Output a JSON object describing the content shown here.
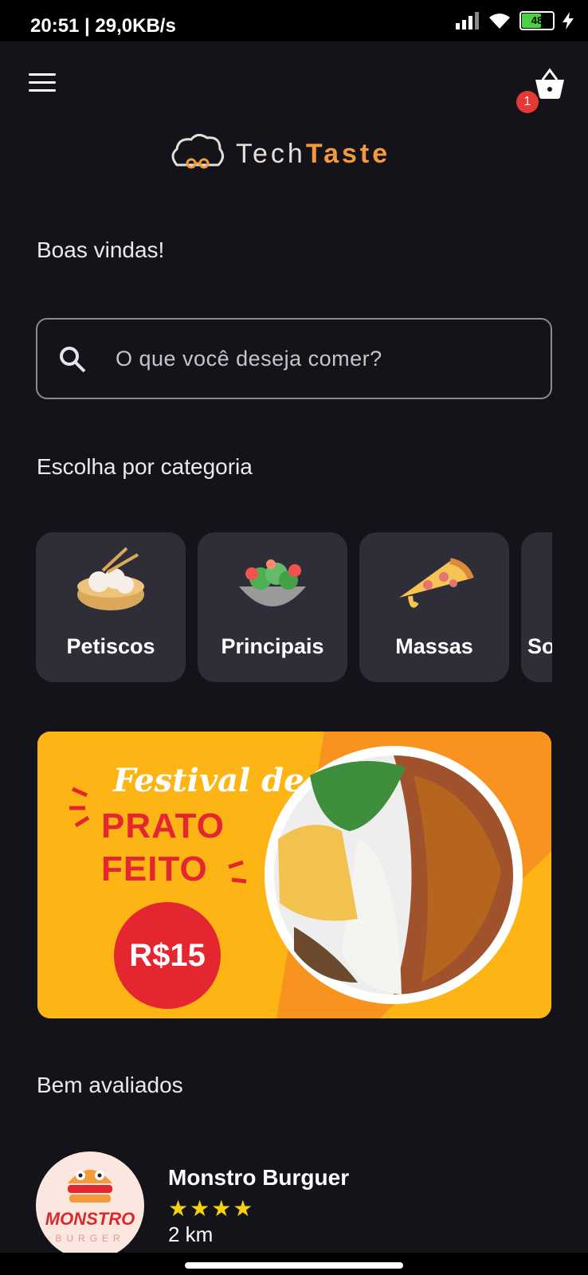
{
  "status_bar": {
    "time": "20:51 | 29,0KB/s",
    "battery": "48"
  },
  "header": {
    "cart_count": "1"
  },
  "logo": {
    "part1": "Tech",
    "part2": "Taste"
  },
  "greeting": "Boas vindas!",
  "search": {
    "placeholder": "O que você deseja comer?"
  },
  "categories": {
    "title": "Escolha por categoria",
    "items": [
      {
        "label": "Petiscos",
        "icon": "dumplings-icon"
      },
      {
        "label": "Principais",
        "icon": "salad-bowl-icon"
      },
      {
        "label": "Massas",
        "icon": "pizza-icon"
      },
      {
        "label": "So",
        "icon": ""
      }
    ]
  },
  "banner": {
    "festival": "Festival de",
    "line1": "PRATO",
    "line2": "FEITO",
    "price": "R$15"
  },
  "top_rated": {
    "title": "Bem avaliados",
    "restaurants": [
      {
        "name": "Monstro Burguer",
        "stars": "★★★★",
        "rating": 4,
        "distance": "2 km",
        "logo_text": "MONSTRO",
        "logo_sub": "BURGER"
      }
    ]
  },
  "colors": {
    "background": "#15131a",
    "card": "#2f2d38",
    "accent": "#f39a3a",
    "badge": "#e53935",
    "star": "#f7d20a"
  }
}
